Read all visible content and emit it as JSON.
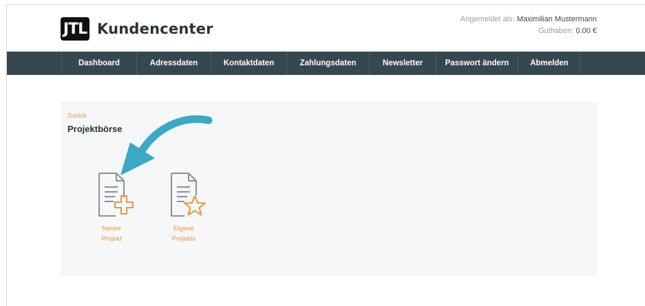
{
  "header": {
    "logo_mark": "JTL",
    "logo_text": "Kundencenter",
    "logged_in_label": "Angemeldet als:",
    "user_name": "Maximilian Mustermann",
    "credit_label": "Guthaben:",
    "credit_value": "0.00 €"
  },
  "nav": {
    "items": [
      {
        "label": "Dashboard"
      },
      {
        "label": "Adressdaten"
      },
      {
        "label": "Kontaktdaten"
      },
      {
        "label": "Zahlungsdaten"
      },
      {
        "label": "Newsletter"
      },
      {
        "label": "Passwort ändern"
      },
      {
        "label": "Abmelden"
      }
    ]
  },
  "main": {
    "back_label": "Zurück",
    "title": "Projektbörse",
    "tiles": [
      {
        "icon": "document-plus-icon",
        "line1": "Neues",
        "line2": "Projekt"
      },
      {
        "icon": "document-star-icon",
        "line1": "Eigene",
        "line2": "Projekte"
      }
    ]
  },
  "colors": {
    "navbar": "#37474f",
    "accent": "#e8953f",
    "annotation_arrow": "#3ba8c4",
    "panel_bg": "#f6f7f8"
  }
}
